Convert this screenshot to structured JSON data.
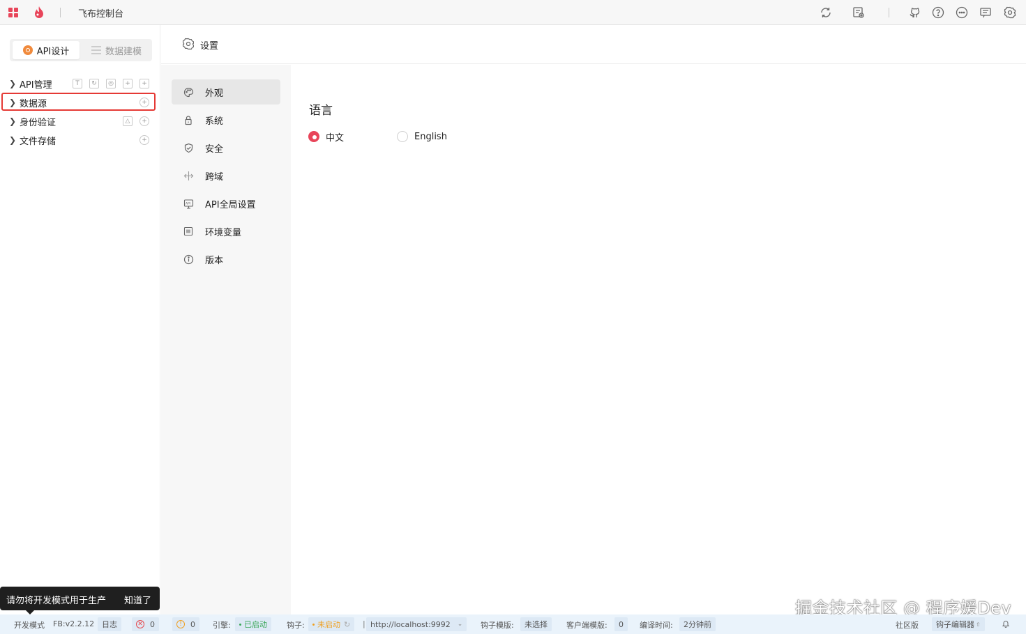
{
  "app": {
    "title": "飞布控制台"
  },
  "left_panel": {
    "tabs": [
      {
        "label": "API设计"
      },
      {
        "label": "数据建模"
      }
    ],
    "tree": [
      {
        "label": "API管理"
      },
      {
        "label": "数据源"
      },
      {
        "label": "身份验证"
      },
      {
        "label": "文件存储"
      }
    ]
  },
  "tooltip": {
    "message": "请勿将开发模式用于生产",
    "ok_label": "知道了"
  },
  "main": {
    "title": "设置"
  },
  "settings_nav": [
    {
      "label": "外观",
      "icon": "palette-icon"
    },
    {
      "label": "系统",
      "icon": "lock-icon"
    },
    {
      "label": "安全",
      "icon": "shield-icon"
    },
    {
      "label": "跨域",
      "icon": "cross-domain-icon"
    },
    {
      "label": "API全局设置",
      "icon": "api-icon"
    },
    {
      "label": "环境变量",
      "icon": "variable-icon"
    },
    {
      "label": "版本",
      "icon": "info-icon"
    }
  ],
  "appearance": {
    "language_title": "语言",
    "options": [
      {
        "label": "中文",
        "selected": true
      },
      {
        "label": "English",
        "selected": false
      }
    ]
  },
  "watermark": "掘金技术社区 @ 程序媛Dev",
  "status": {
    "mode": "开发模式",
    "version": "FB:v2.2.12",
    "log": "日志",
    "errors": "0",
    "warnings": "0",
    "engine_label": "引擎:",
    "engine_status": "已启动",
    "hook_label": "钩子:",
    "hook_status": "未启动",
    "hook_url": "http://localhost:9992",
    "hook_template_label": "钩子模版:",
    "hook_template_value": "未选择",
    "client_template_label": "客户端模版:",
    "client_template_value": "0",
    "compile_label": "编译时间:",
    "compile_value": "2分钟前",
    "community": "社区版",
    "hook_editor": "钩子编辑器"
  },
  "colors": {
    "accent": "#e8455a",
    "highlight": "#e53935",
    "engine_ok": "#3aa757",
    "hook_off": "#f0a020",
    "error": "#e5484d",
    "warn": "#f0a020"
  }
}
